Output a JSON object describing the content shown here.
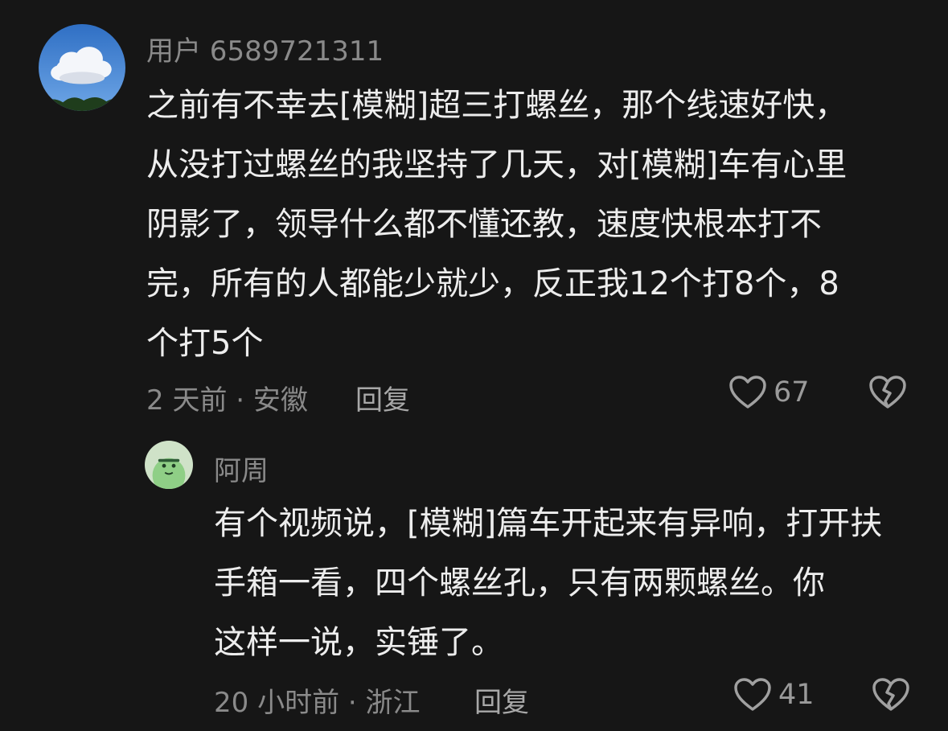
{
  "comments": [
    {
      "username": "用户 6589721311",
      "avatar_icon": "cloud-sky-avatar",
      "content_lines": [
        "之前有不幸去[模糊]超三打螺丝，那个线速好快，",
        "从没打过螺丝的我坚持了几天，对[模糊]车有心里",
        "阴影了，领导什么都不懂还教，速度快根本打不",
        "完，所有的人都能少就少，反正我12个打8个，8",
        "个打5个"
      ],
      "meta": "2 天前 · 安徽",
      "reply_label": "回复",
      "like_icon": "heart-outline-icon",
      "like_count": "67",
      "dislike_icon": "broken-heart-icon"
    },
    {
      "username": "阿周",
      "avatar_icon": "green-cartoon-avatar",
      "content_lines": [
        "有个视频说，[模糊]篇车开起来有异响，打开扶",
        "手箱一看，四个螺丝孔，只有两颗螺丝。你",
        "这样一说，实锤了。"
      ],
      "meta": "20 小时前 · 浙江",
      "reply_label": "回复",
      "like_icon": "heart-outline-icon",
      "like_count": "41",
      "dislike_icon": "broken-heart-icon"
    }
  ],
  "colors": {
    "background": "#161616",
    "text_primary": "#ededed",
    "text_secondary": "#8a8a8a",
    "icon": "#a0a0a0"
  }
}
